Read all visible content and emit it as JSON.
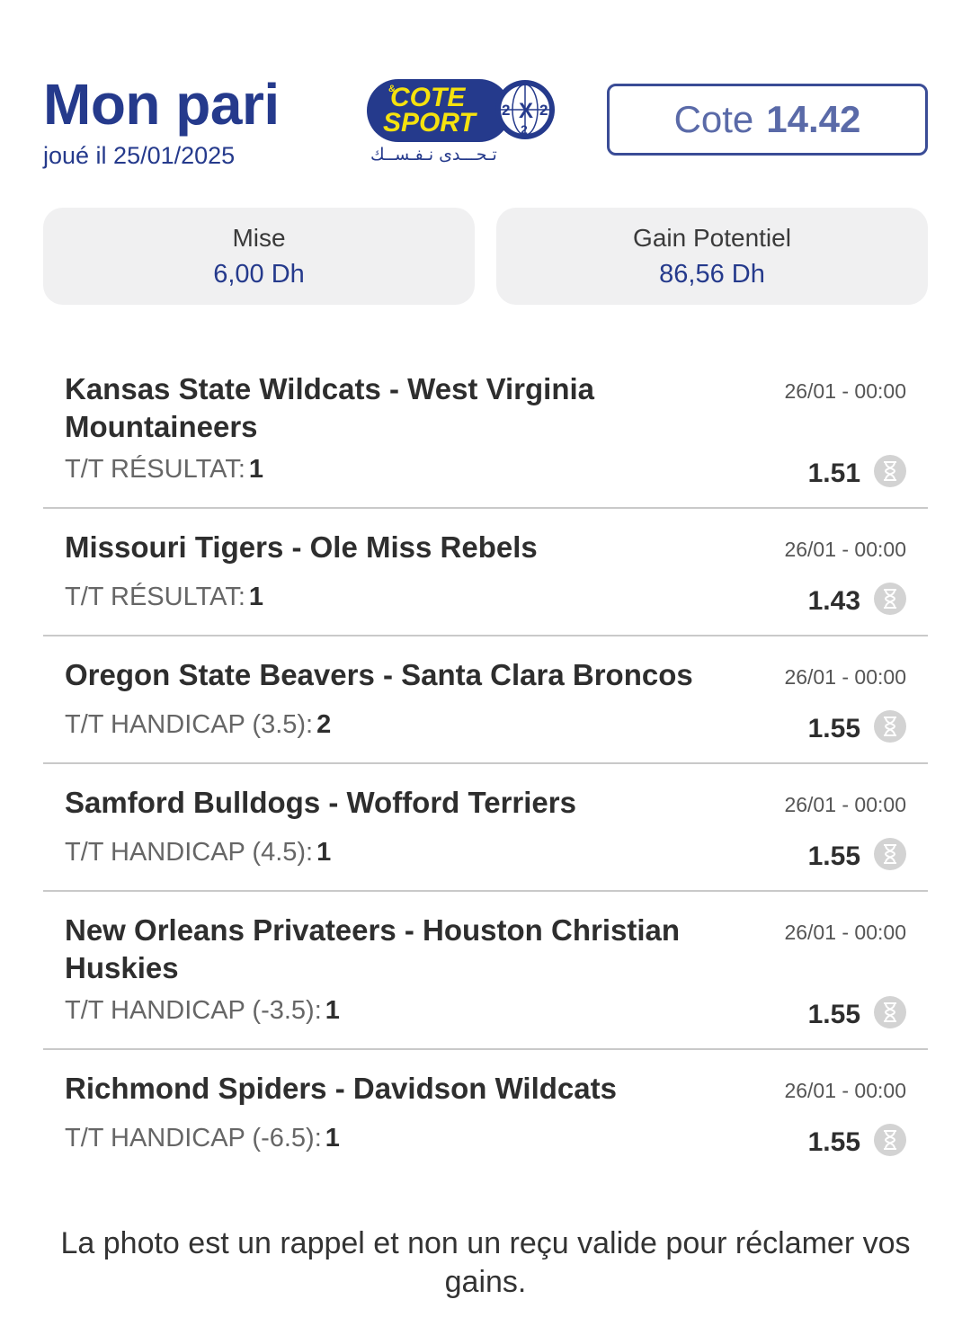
{
  "header": {
    "title": "Mon pari",
    "played_date": "joué il 25/01/2025",
    "cote_label": "Cote",
    "cote_value": "14.42"
  },
  "logo": {
    "line1": "COTE",
    "amp": "&",
    "line2": "SPORT",
    "arabic": "تـحـــدى نـفـســك",
    "ball_center": "X",
    "ball_left": "2",
    "ball_right": "2",
    "ball_bottom": "2",
    "colors": {
      "blue": "#253a8c",
      "yellow": "#f5e20e"
    }
  },
  "summary": {
    "stake_label": "Mise",
    "stake_value": "6,00 Dh",
    "gain_label": "Gain Potentiel",
    "gain_value": "86,56 Dh"
  },
  "bets": [
    {
      "match": "Kansas State Wildcats - West Virginia Mountaineers",
      "date": "26/01 - 00:00",
      "market": "T/T RÉSULTAT:",
      "pick": "1",
      "odd": "1.51",
      "status_icon": "hourglass-icon"
    },
    {
      "match": "Missouri Tigers - Ole Miss Rebels",
      "date": "26/01 - 00:00",
      "market": "T/T RÉSULTAT:",
      "pick": "1",
      "odd": "1.43",
      "status_icon": "hourglass-icon"
    },
    {
      "match": "Oregon State Beavers - Santa Clara Broncos",
      "date": "26/01 - 00:00",
      "market": "T/T HANDICAP (3.5):",
      "pick": "2",
      "odd": "1.55",
      "status_icon": "hourglass-icon"
    },
    {
      "match": "Samford Bulldogs - Wofford Terriers",
      "date": "26/01 - 00:00",
      "market": "T/T HANDICAP (4.5):",
      "pick": "1",
      "odd": "1.55",
      "status_icon": "hourglass-icon"
    },
    {
      "match": "New Orleans Privateers - Houston Christian Huskies",
      "date": "26/01 - 00:00",
      "market": "T/T HANDICAP (-3.5):",
      "pick": "1",
      "odd": "1.55",
      "status_icon": "hourglass-icon"
    },
    {
      "match": "Richmond Spiders - Davidson Wildcats",
      "date": "26/01 - 00:00",
      "market": "T/T HANDICAP (-6.5):",
      "pick": "1",
      "odd": "1.55",
      "status_icon": "hourglass-icon"
    }
  ],
  "disclaimer": "La photo est un rappel et non un reçu valide pour réclamer vos gains."
}
